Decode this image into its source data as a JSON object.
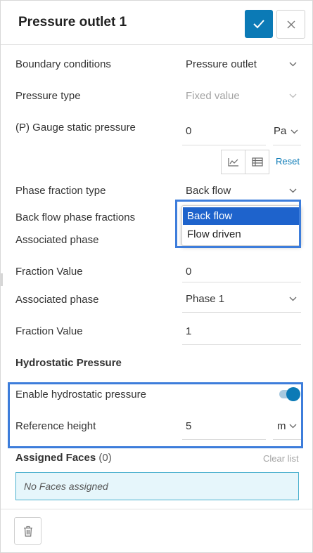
{
  "header": {
    "title": "Pressure outlet 1",
    "confirm_icon": "check-icon",
    "close_icon": "close-icon"
  },
  "form": {
    "boundary_conditions": {
      "label": "Boundary conditions",
      "value": "Pressure outlet"
    },
    "pressure_type": {
      "label": "Pressure type",
      "value": "Fixed value",
      "disabled": true
    },
    "gauge_static_pressure": {
      "label": "(P) Gauge static pressure",
      "value": "0",
      "unit": "Pa"
    },
    "pressure_tools": {
      "chart_icon": "chart-icon",
      "table_icon": "table-icon",
      "reset_label": "Reset"
    },
    "phase_fraction_type": {
      "label": "Phase fraction type",
      "value": "Back flow"
    },
    "back_flow_phase_fractions": {
      "label": "Back flow phase fractions"
    },
    "associated_phase_1": {
      "label": "Associated phase"
    },
    "fraction_value_1": {
      "label": "Fraction Value",
      "value": "0"
    },
    "associated_phase_2": {
      "label": "Associated phase",
      "value": "Phase 1"
    },
    "fraction_value_2": {
      "label": "Fraction Value",
      "value": "1"
    }
  },
  "dropdown": {
    "options": [
      "Back flow",
      "Flow driven"
    ],
    "selected": "Back flow"
  },
  "hydrostatic": {
    "heading": "Hydrostatic Pressure",
    "enable_label": "Enable hydrostatic pressure",
    "enabled": true,
    "reference_height": {
      "label": "Reference height",
      "value": "5",
      "unit": "m"
    }
  },
  "assigned_faces": {
    "title": "Assigned Faces",
    "count": "(0)",
    "clear_label": "Clear list",
    "empty_text": "No Faces assigned"
  },
  "footer": {
    "delete_icon": "trash-icon"
  },
  "colors": {
    "accent": "#0b7ab6",
    "highlight": "#3d7ddb",
    "selected_option": "#1e63cc",
    "faces_box_bg": "#e6f6fb"
  }
}
